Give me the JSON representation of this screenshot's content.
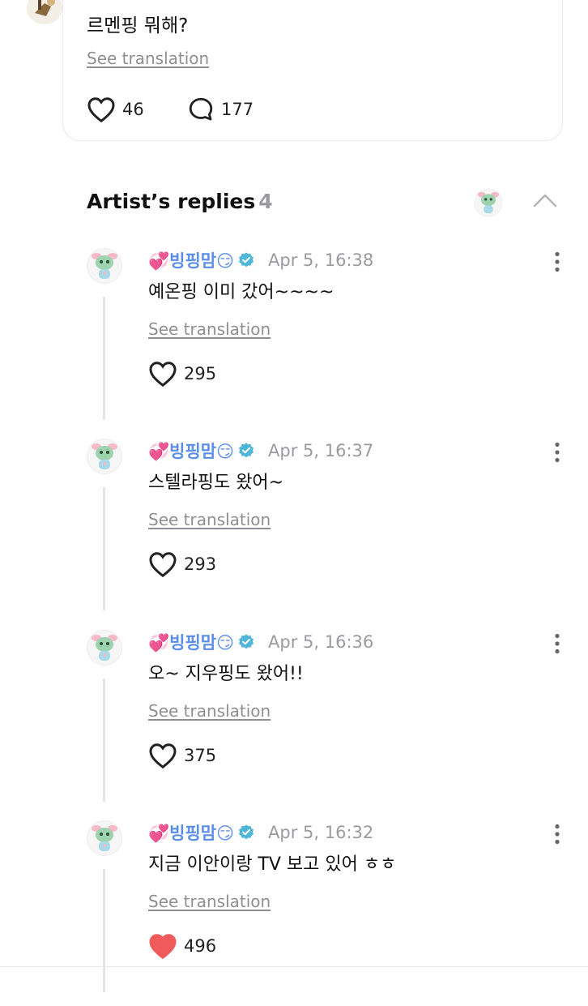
{
  "post": {
    "text": "르멘핑 뭐해?",
    "see_translation": "See translation",
    "like_count": "46",
    "comment_count": "177"
  },
  "artist_replies": {
    "title": "Artist’s replies",
    "count": "4"
  },
  "replies": [
    {
      "name": "💞빙핑맘😏",
      "time": "Apr 5, 16:38",
      "text": "예온핑 이미 갔어~~~~",
      "see_translation": "See translation",
      "likes": "295",
      "liked": false
    },
    {
      "name": "💞빙핑맘😏",
      "time": "Apr 5, 16:37",
      "text": "스텔라핑도 왔어~",
      "see_translation": "See translation",
      "likes": "293",
      "liked": false
    },
    {
      "name": "💞빙핑맘😏",
      "time": "Apr 5, 16:36",
      "text": "오~ 지우핑도 왔어!!",
      "see_translation": "See translation",
      "likes": "375",
      "liked": false
    },
    {
      "name": "💞빙핑맘😏",
      "time": "Apr 5, 16:32",
      "text": "지금 이안이랑 TV 보고 있어 ㅎㅎ",
      "see_translation": "See translation",
      "likes": "496",
      "liked": true
    }
  ],
  "colors": {
    "name_blue": "#5b8dea",
    "verified": "#4fb6d9",
    "liked_red": "#ef5b5b"
  }
}
